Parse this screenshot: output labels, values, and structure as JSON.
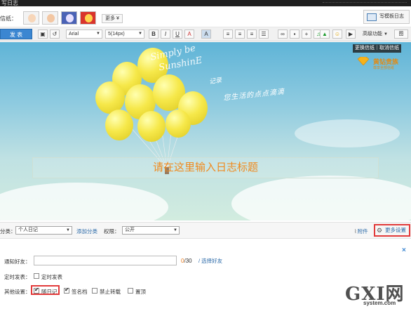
{
  "top": {
    "title": "写日志"
  },
  "stationery": {
    "label": "信纸：",
    "more_label": "更多 ¥",
    "template_label": "写模板日志"
  },
  "toolbar": {
    "publish_label": "发 表",
    "font": "Arial",
    "size": "5(14px)",
    "bold": "B",
    "italic": "I",
    "underline": "U",
    "font_color": "A",
    "bg_color": "A",
    "advanced_label": "高级功能",
    "advanced_arrow": "▼",
    "dropdown_arrow": "▼",
    "image_label": "图"
  },
  "banner": {
    "ad_label": "更换信纸｜取消信纸",
    "vip_title": "黄钻贵族",
    "vip_sub": "尊享全部信纸",
    "script_line1": "Simply be",
    "script_line2": "SunshinE",
    "hand_line1": "记录",
    "hand_line2": "您生活的点点滴滴",
    "title_placeholder": "请在这里输入日志标题"
  },
  "category": {
    "label": "分类：",
    "value": "个人日记",
    "add_link": "添加分类",
    "permission_label": "权限：",
    "permission_value": "公开",
    "attach_label": "附件",
    "more_settings": "更多设置"
  },
  "panel": {
    "close": "×",
    "notify_label": "通知好友：",
    "notify_value": "",
    "notify_count_prefix": "0",
    "notify_count_suffix": "30",
    "notify_link": "/ 选择好友",
    "schedule_label": "定时发表：",
    "schedule_option": "定时发表",
    "other_label": "其他设置：",
    "options": [
      "随日记",
      "签名档",
      "禁止转载",
      "置顶"
    ]
  },
  "watermark": {
    "big": "GXI网",
    "small": "system.com"
  },
  "colors": {
    "accent": "#3b86d1",
    "highlight": "#e23b3b",
    "title": "#f08a1f"
  }
}
